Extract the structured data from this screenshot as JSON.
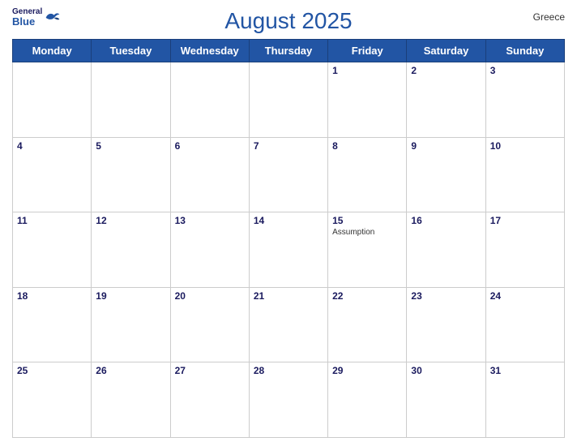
{
  "header": {
    "title": "August 2025",
    "country": "Greece",
    "logo": {
      "general": "General",
      "blue": "Blue"
    }
  },
  "weekdays": [
    "Monday",
    "Tuesday",
    "Wednesday",
    "Thursday",
    "Friday",
    "Saturday",
    "Sunday"
  ],
  "weeks": [
    [
      {
        "day": "",
        "empty": true
      },
      {
        "day": "",
        "empty": true
      },
      {
        "day": "",
        "empty": true
      },
      {
        "day": "",
        "empty": true
      },
      {
        "day": "1"
      },
      {
        "day": "2"
      },
      {
        "day": "3"
      }
    ],
    [
      {
        "day": "4"
      },
      {
        "day": "5"
      },
      {
        "day": "6"
      },
      {
        "day": "7"
      },
      {
        "day": "8"
      },
      {
        "day": "9"
      },
      {
        "day": "10"
      }
    ],
    [
      {
        "day": "11"
      },
      {
        "day": "12"
      },
      {
        "day": "13"
      },
      {
        "day": "14"
      },
      {
        "day": "15",
        "event": "Assumption"
      },
      {
        "day": "16"
      },
      {
        "day": "17"
      }
    ],
    [
      {
        "day": "18"
      },
      {
        "day": "19"
      },
      {
        "day": "20"
      },
      {
        "day": "21"
      },
      {
        "day": "22"
      },
      {
        "day": "23"
      },
      {
        "day": "24"
      }
    ],
    [
      {
        "day": "25"
      },
      {
        "day": "26"
      },
      {
        "day": "27"
      },
      {
        "day": "28"
      },
      {
        "day": "29"
      },
      {
        "day": "30"
      },
      {
        "day": "31"
      }
    ]
  ],
  "colors": {
    "header_bg": "#2255a4",
    "header_text": "#ffffff",
    "day_num_color": "#1a1a5e",
    "title_color": "#2255a4"
  }
}
